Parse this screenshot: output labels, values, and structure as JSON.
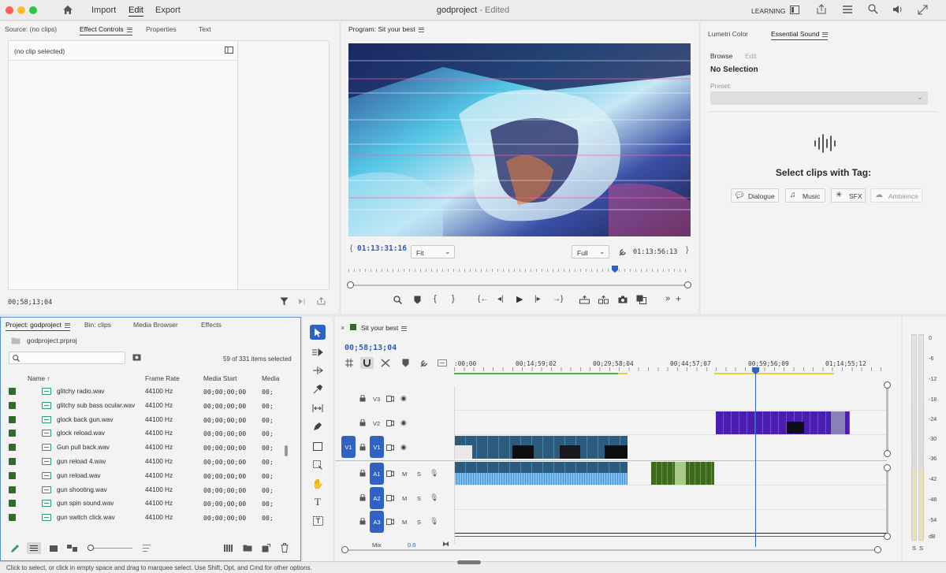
{
  "menubar": {
    "home_icon": "home-icon",
    "items": [
      "Import",
      "Edit",
      "Export"
    ],
    "title": "godproject",
    "title_suffix": " - Edited",
    "learning": "LEARNING"
  },
  "source_panel": {
    "tabs": [
      "Source: (no clips)",
      "Effect Controls",
      "Properties",
      "Text"
    ],
    "no_clip": "(no clip selected)",
    "timecode": "00;58;13;04"
  },
  "program_panel": {
    "title": "Program: Sit your best",
    "timecode": "01:13:31:16",
    "fit": "Fit",
    "quality": "Full",
    "duration": "01:13:56:13"
  },
  "sound_panel": {
    "tabs": [
      "Lumetri Color",
      "Essential Sound"
    ],
    "subtabs": [
      "Browse",
      "Edit"
    ],
    "no_selection": "No Selection",
    "preset_label": "Preset:",
    "select_title": "Select clips with Tag:",
    "tags": [
      "Dialogue",
      "Music",
      "SFX",
      "Ambience"
    ]
  },
  "project_panel": {
    "tabs": [
      "Project: godproject",
      "Bin: clips",
      "Media Browser",
      "Effects"
    ],
    "file": "godproject.prproj",
    "count": "59 of 331 items selected",
    "columns": [
      "Name",
      "Frame Rate",
      "Media Start",
      "Media"
    ],
    "rows": [
      {
        "name": "glitchy radio.wav",
        "rate": "44100 Hz",
        "start": "00;00;00;00",
        "media": "00;"
      },
      {
        "name": "glitchy sub bass ocular.wav",
        "rate": "44100 Hz",
        "start": "00;00;00;00",
        "media": "00;"
      },
      {
        "name": "glock back gun.wav",
        "rate": "44100 Hz",
        "start": "00;00;00;00",
        "media": "00;"
      },
      {
        "name": "glock reload.wav",
        "rate": "44100 Hz",
        "start": "00;00;00;00",
        "media": "00;"
      },
      {
        "name": "Gun pull back.wav",
        "rate": "44100 Hz",
        "start": "00;00;00;00",
        "media": "00;"
      },
      {
        "name": "gun reload 4.wav",
        "rate": "44100 Hz",
        "start": "00;00;00;00",
        "media": "00;"
      },
      {
        "name": "gun reload.wav",
        "rate": "44100 Hz",
        "start": "00;00;00;00",
        "media": "00;"
      },
      {
        "name": "gun shooting.wav",
        "rate": "44100 Hz",
        "start": "00;00;00;00",
        "media": "00;"
      },
      {
        "name": "gun spin sound.wav",
        "rate": "44100 Hz",
        "start": "00;00;00;00",
        "media": "00;"
      },
      {
        "name": "gun switch click.wav",
        "rate": "44100 Hz",
        "start": "00;00;00;00",
        "media": "00;"
      }
    ]
  },
  "timeline": {
    "sequence": "Sit your best",
    "timecode": "00;58;13;04",
    "ruler": [
      ":00;00",
      "00;14;59;02",
      "00;29;58;04",
      "00;44;57;07",
      "00;59;56;09",
      "01;14;55;12"
    ],
    "tracks": [
      "V3",
      "V2",
      "V1",
      "A1",
      "A2",
      "A3"
    ],
    "src_v": "V1",
    "mix": "Mix",
    "mix_val": "0.0",
    "ms": [
      "M",
      "S"
    ]
  },
  "meter": {
    "labels": [
      "0",
      "-6",
      "-12",
      "-18",
      "-24",
      "-30",
      "-36",
      "-42",
      "-48",
      "-54",
      "dB"
    ],
    "ss": [
      "S",
      "S"
    ]
  },
  "status": {
    "text": "Click to select, or click in empty space and drag to marquee select. Use Shift, Opt, and Cmd for other options."
  },
  "colors": {
    "accent": "#2f62c2",
    "label_green": "#2f6b2a",
    "video_clip": "#4a1fb0",
    "audio_clip": "#4a90d9"
  }
}
